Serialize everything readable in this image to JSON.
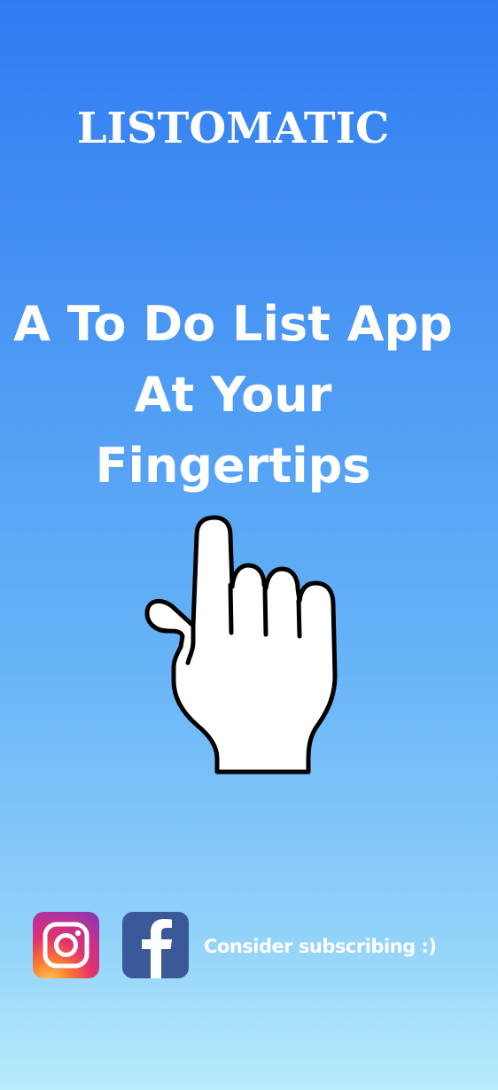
{
  "app": {
    "title": "LISTOMATIC"
  },
  "tagline": {
    "line1": "A To Do List App",
    "line2": "At Your",
    "line3": "Fingertips"
  },
  "illustration": {
    "icon": "pointing-hand-icon"
  },
  "social": {
    "instagram_icon": "instagram-icon",
    "facebook_icon": "facebook-icon",
    "cta": "Consider subscribing :)"
  },
  "colors": {
    "background_top": "#2f7cf2",
    "background_bottom": "#b8ecfb",
    "text": "#ffffff",
    "facebook_brand": "#3b5998",
    "instagram_gradient": [
      "#fdcb52",
      "#fd7a2e",
      "#e2336c",
      "#c5308f",
      "#7d3ab9"
    ]
  }
}
